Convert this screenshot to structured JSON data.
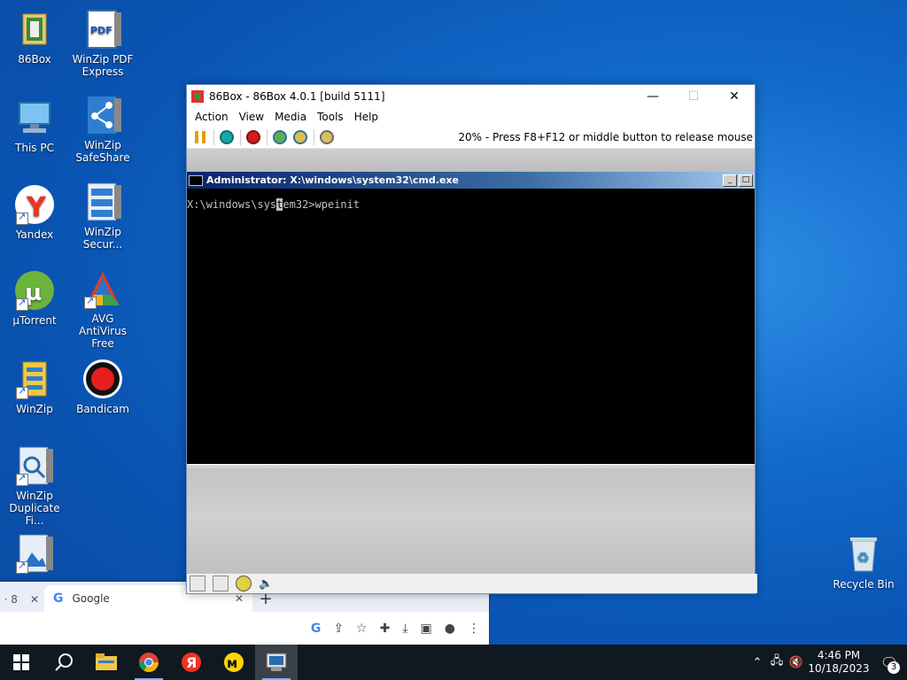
{
  "desktop": {
    "icons": [
      {
        "label": "86Box"
      },
      {
        "label": "WinZip PDF Express"
      },
      {
        "label": "This PC"
      },
      {
        "label": "WinZip SafeShare"
      },
      {
        "label": "Yandex"
      },
      {
        "label": "WinZip Secur..."
      },
      {
        "label": "µTorrent"
      },
      {
        "label": "AVG AntiVirus Free"
      },
      {
        "label": "WinZip"
      },
      {
        "label": "Bandicam"
      },
      {
        "label": "WinZip Duplicate Fi..."
      },
      {
        "label": "Recycle Bin"
      }
    ],
    "icon_pdf_text": "PDF"
  },
  "vm_window": {
    "title": "86Box - 86Box 4.0.1 [build 5111]",
    "controls": {
      "minimize": "—",
      "maximize": "☐",
      "close": "✕"
    },
    "menu": [
      "Action",
      "View",
      "Media",
      "Tools",
      "Help"
    ],
    "status_message": "20% - Press F8+F12 or middle button to release mouse"
  },
  "cmd_window": {
    "title": "Administrator: X:\\windows\\system32\\cmd.exe",
    "prompt_before_cursor": "X:\\windows\\sys",
    "cursor_char": "t",
    "prompt_after_cursor": "em32>wpeinit",
    "min_btn": "_",
    "max_btn": "□"
  },
  "chrome": {
    "prev_tab_label": "· 8",
    "prev_tab_close": "✕",
    "tab_label": "Google",
    "tab_close": "✕",
    "new_tab": "+"
  },
  "taskbar": {
    "time": "4:46 PM",
    "date": "10/18/2023",
    "notification_count": "3"
  },
  "colors": {
    "desktop_blue": "#0a54b3",
    "cmd_title_blue": "#0a246a",
    "taskbar": "#101820"
  }
}
